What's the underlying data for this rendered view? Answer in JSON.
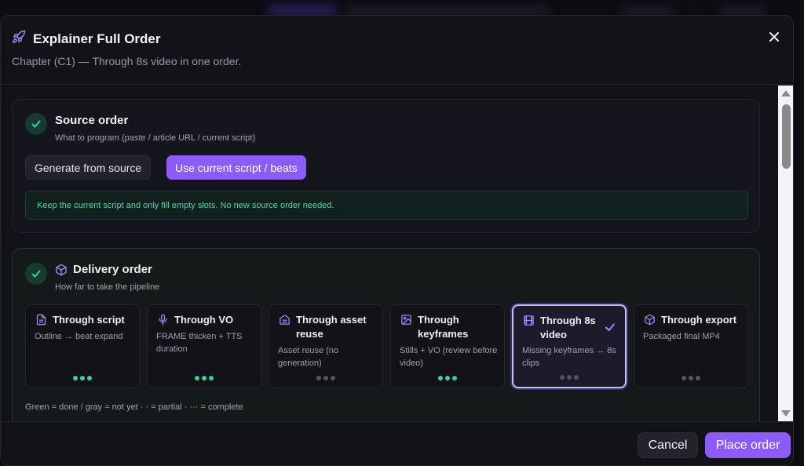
{
  "modal": {
    "title": "Explainer Full Order",
    "subtitle": "Chapter (C1) — Through 8s video in one order.",
    "icons": {
      "title": "rocket-icon",
      "close": "close-icon"
    }
  },
  "source_order": {
    "title": "Source order",
    "description": "What to program (paste / article URL / current script)",
    "options": [
      {
        "label": "Generate from source",
        "selected": false
      },
      {
        "label": "Use current script / beats",
        "selected": true
      }
    ],
    "notice": "Keep the current script and only fill empty slots. No new source order needed."
  },
  "delivery_order": {
    "title": "Delivery order",
    "description": "How far to take the pipeline",
    "options": [
      {
        "title": "Through script",
        "description": "Outline → beat expand",
        "icon": "document-icon",
        "selected": false,
        "progress": [
          true,
          true,
          true
        ]
      },
      {
        "title": "Through VO",
        "description": "FRAME thicken + TTS duration",
        "icon": "microphone-icon",
        "selected": false,
        "progress": [
          true,
          true,
          true
        ]
      },
      {
        "title": "Through asset reuse",
        "description": "Asset reuse (no generation)",
        "icon": "archive-icon",
        "selected": false,
        "progress": [
          false,
          false,
          false
        ]
      },
      {
        "title": "Through keyframes",
        "description": "Stills + VO (review before video)",
        "icon": "image-icon",
        "selected": false,
        "progress": [
          true,
          true,
          true
        ]
      },
      {
        "title": "Through 8s video",
        "description": "Missing keyframes → 8s clips",
        "icon": "film-icon",
        "selected": true,
        "progress": [
          false,
          false,
          false
        ]
      },
      {
        "title": "Through export",
        "description": "Packaged final MP4",
        "icon": "package-icon",
        "selected": false,
        "progress": [
          false,
          false,
          false
        ]
      }
    ],
    "legend": "Green = done / gray = not yet · · = partial · ··· = complete"
  },
  "footer": {
    "cancel_label": "Cancel",
    "place_label": "Place order"
  },
  "colors": {
    "accent": "#8b5cf6",
    "success": "#3ecf93",
    "background": "#121219"
  }
}
